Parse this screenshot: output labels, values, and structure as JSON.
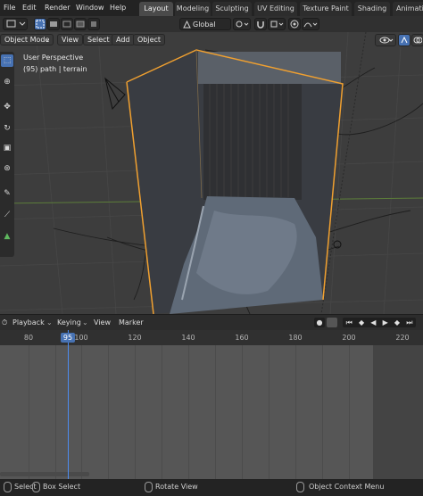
{
  "menubar": {
    "menus": [
      "File",
      "Edit",
      "Render",
      "Window",
      "Help"
    ],
    "workspaces": [
      "Layout",
      "Modeling",
      "Sculpting",
      "UV Editing",
      "Texture Paint",
      "Shading",
      "Animati"
    ],
    "active_workspace": "Layout"
  },
  "toolbar": {
    "orientation": "Global"
  },
  "viewport_header": {
    "mode": "Object Mode",
    "view": "View",
    "select": "Select",
    "add": "Add",
    "object": "Object"
  },
  "viewport_info": {
    "perspective": "User Perspective",
    "object": "(95) path | terrain"
  },
  "timeline": {
    "playback": "Playback",
    "keying": "Keying",
    "view": "View",
    "marker": "Marker",
    "current_frame": "95",
    "ticks": [
      "80",
      "100",
      "120",
      "140",
      "160",
      "180",
      "200",
      "220"
    ]
  },
  "statusbar": {
    "select": "Select",
    "box_select": "Box Select",
    "rotate_view": "Rotate View",
    "context_menu": "Object Context Menu"
  },
  "colors": {
    "accent": "#4772b3",
    "selection_outline": "#f0a030",
    "viewport_bg": "#3d3d3d",
    "timeline_bg": "#565656"
  }
}
